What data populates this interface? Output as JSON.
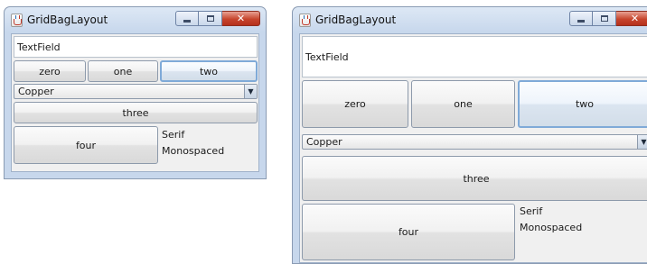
{
  "windows": [
    {
      "title": "GridBagLayout",
      "textfield": "TextField",
      "buttons": {
        "zero": "zero",
        "one": "one",
        "two": "two",
        "three": "three",
        "four": "four"
      },
      "combo": {
        "selected": "Copper",
        "arrow_icon": "▼"
      },
      "list": [
        "Serif",
        "Monospaced"
      ],
      "controls": {
        "minimize_icon": "minimize-icon",
        "maximize_icon": "maximize-icon",
        "close_icon": "close-icon",
        "close_glyph": "✕"
      }
    },
    {
      "title": "GridBagLayout",
      "textfield": "TextField",
      "buttons": {
        "zero": "zero",
        "one": "one",
        "two": "two",
        "three": "three",
        "four": "four"
      },
      "combo": {
        "selected": "Copper",
        "arrow_icon": "▼"
      },
      "list": [
        "Serif",
        "Monospaced"
      ],
      "controls": {
        "minimize_icon": "minimize-icon",
        "maximize_icon": "maximize-icon",
        "close_icon": "close-icon",
        "close_glyph": "✕"
      }
    }
  ],
  "colors": {
    "window_frame": "#c7d7ec",
    "client_bg": "#f0f0f0",
    "focus_border": "#7faad8",
    "close_button": "#c7452d"
  }
}
